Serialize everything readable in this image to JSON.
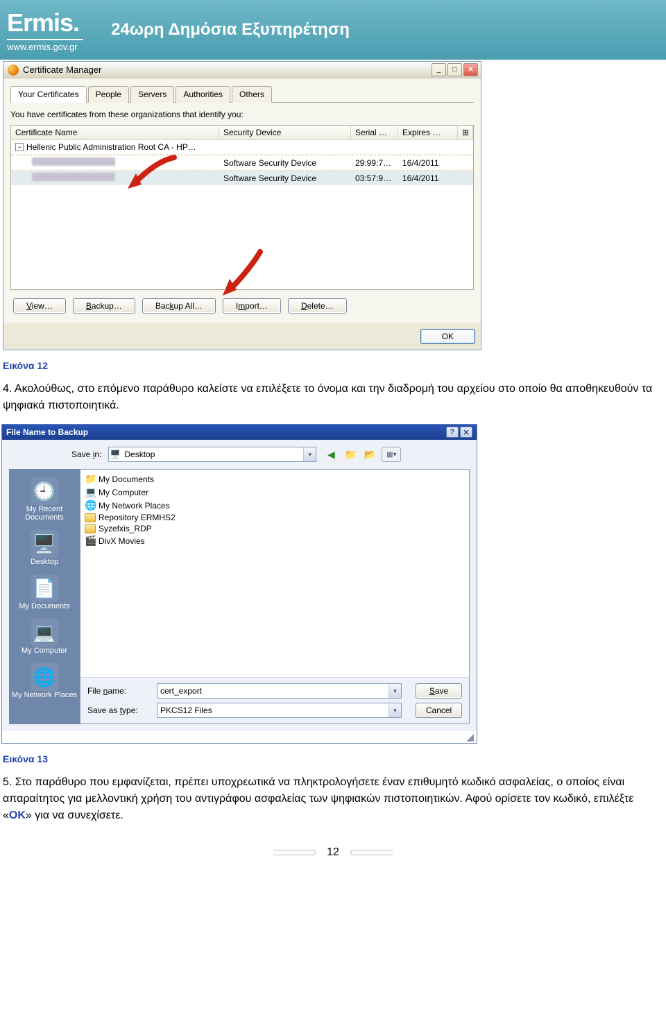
{
  "header": {
    "logo": "Ermis.",
    "url": "www.ermis.gov.gr",
    "tagline": "24ωρη Δημόσια Εξυπηρέτηση"
  },
  "certmgr": {
    "title": "Certificate Manager",
    "tabs": [
      "Your Certificates",
      "People",
      "Servers",
      "Authorities",
      "Others"
    ],
    "caption": "You have certificates from these organizations that identify you:",
    "columns": {
      "name": "Certificate Name",
      "device": "Security Device",
      "serial": "Serial …",
      "expires": "Expires …"
    },
    "root": "Hellenic Public Administration Root CA - HP…",
    "rows": [
      {
        "device": "Software Security Device",
        "serial": "29:99:7…",
        "expires": "16/4/2011"
      },
      {
        "device": "Software Security Device",
        "serial": "03:57:9…",
        "expires": "16/4/2011"
      }
    ],
    "buttons": {
      "view": "View…",
      "backup": "Backup…",
      "backupall": "Backup All…",
      "import": "Import…",
      "delete": "Delete…"
    },
    "ok": "OK"
  },
  "fig12": "Εικόνα 12",
  "step4": "4. Ακολούθως, στο επόμενο παράθυρο καλείστε να επιλέξετε το όνομα και την διαδρομή του αρχείου στο οποίο θα αποθηκευθούν τα ψηφιακά πιστοποιητικά.",
  "savedlg": {
    "title": "File Name to Backup",
    "savein_label": "Save in:",
    "savein_value": "Desktop",
    "places": [
      "My Recent Documents",
      "Desktop",
      "My Documents",
      "My Computer",
      "My Network Places"
    ],
    "files": [
      "My Documents",
      "My Computer",
      "My Network Places",
      "Repository ERMHS2",
      "Syzefxis_RDP",
      "DivX Movies"
    ],
    "filename_label": "File name:",
    "filename_value": "cert_export",
    "type_label": "Save as type:",
    "type_value": "PKCS12 Files",
    "save": "Save",
    "cancel": "Cancel"
  },
  "fig13": "Εικόνα 13",
  "step5_a": "5. Στο παράθυρο που εμφανίζεται, πρέπει υποχρεωτικά να πληκτρολογήσετε έναν επιθυμητό κωδικό ασφαλείας, ο οποίος είναι απαραίτητος για μελλοντική χρήση του αντιγράφου ασφαλείας των ψηφιακών πιστοποιητικών. Αφού ορίσετε τον κωδικό, επιλέξτε «",
  "step5_ok": "ΟΚ",
  "step5_b": "» για να συνεχίσετε.",
  "page_number": "12"
}
